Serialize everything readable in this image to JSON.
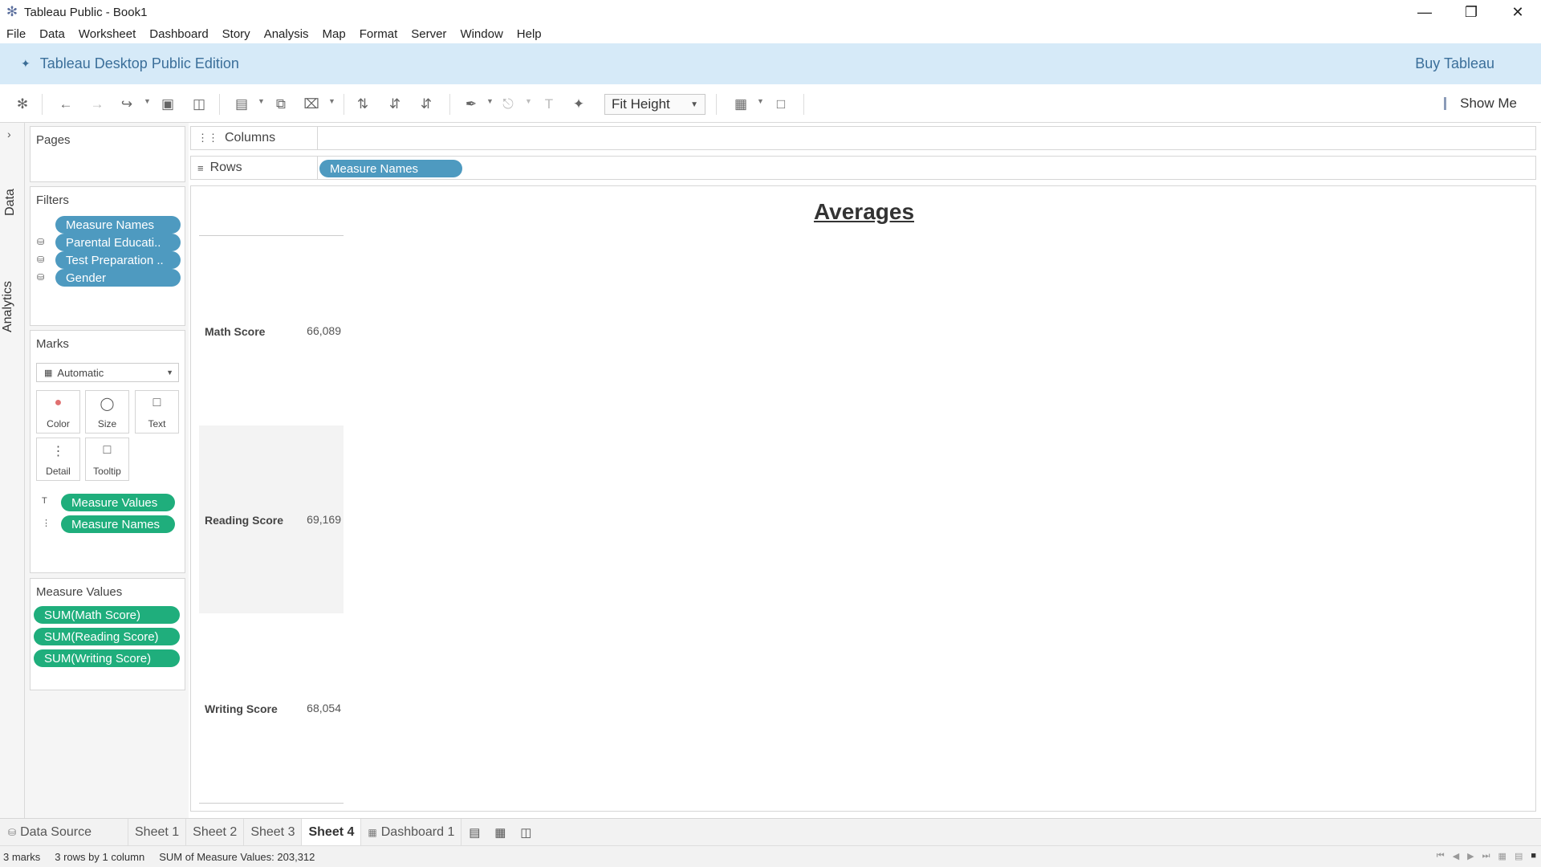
{
  "titlebar": {
    "title": "Tableau Public - Book1"
  },
  "menu": [
    "File",
    "Data",
    "Worksheet",
    "Dashboard",
    "Story",
    "Analysis",
    "Map",
    "Format",
    "Server",
    "Window",
    "Help"
  ],
  "banner": {
    "edition": "Tableau Desktop Public Edition",
    "buy": "Buy Tableau"
  },
  "toolbar": {
    "fit": "Fit Height",
    "show_me": "Show Me"
  },
  "side_tabs": {
    "data": "Data",
    "analytics": "Analytics"
  },
  "pages": {
    "title": "Pages"
  },
  "filters": {
    "title": "Filters",
    "items": [
      "Measure Names",
      "Parental Educati..",
      "Test Preparation ..",
      "Gender"
    ]
  },
  "marks": {
    "title": "Marks",
    "type": "Automatic",
    "buttons": [
      "Color",
      "Size",
      "Text",
      "Detail",
      "Tooltip"
    ],
    "pills": [
      "Measure Values",
      "Measure Names"
    ]
  },
  "measure_values": {
    "title": "Measure Values",
    "items": [
      "SUM(Math Score)",
      "SUM(Reading Score)",
      "SUM(Writing Score)"
    ]
  },
  "shelves": {
    "columns_label": "Columns",
    "rows_label": "Rows",
    "rows_pill": "Measure Names"
  },
  "view": {
    "title": "Averages",
    "rows": [
      {
        "label": "Math Score",
        "value": "66,089"
      },
      {
        "label": "Reading Score",
        "value": "69,169"
      },
      {
        "label": "Writing Score",
        "value": "68,054"
      }
    ]
  },
  "tabs": {
    "data_source": "Data Source",
    "sheets": [
      "Sheet 1",
      "Sheet 2",
      "Sheet 3",
      "Sheet 4"
    ],
    "active": "Sheet 4",
    "dashboard": "Dashboard 1"
  },
  "status": {
    "marks": "3 marks",
    "rows": "3 rows by 1 column",
    "sum": "SUM of Measure Values: 203,312"
  }
}
